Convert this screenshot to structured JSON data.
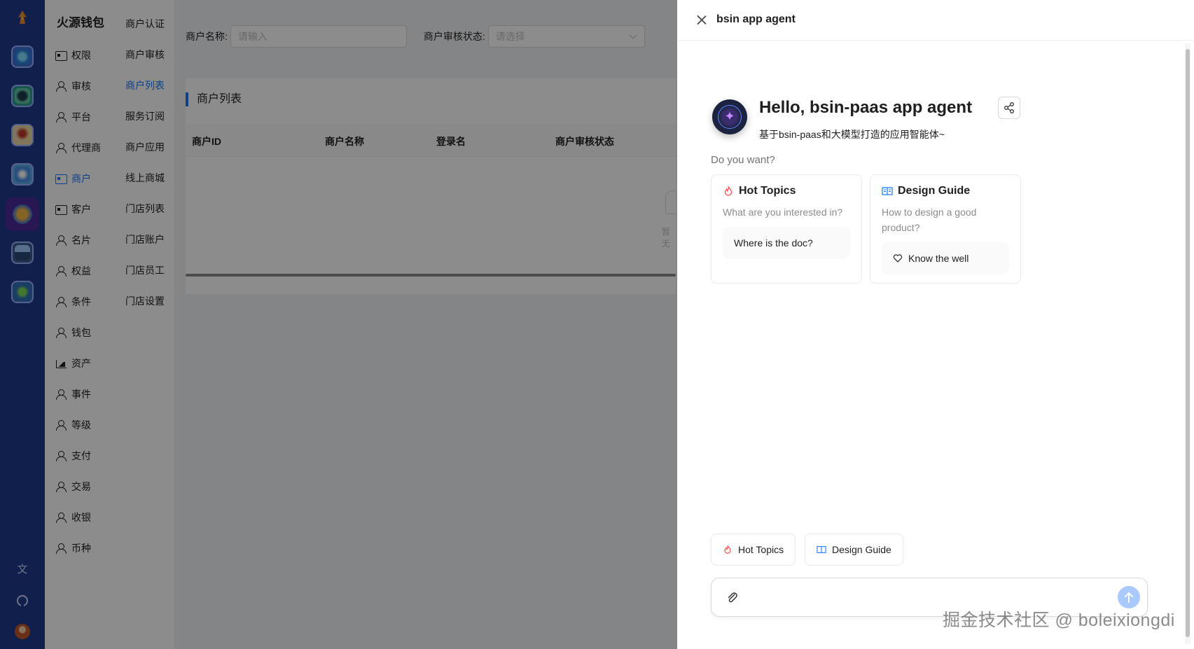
{
  "app": {
    "brand": "火源钱包"
  },
  "menu1": [
    {
      "label": "权限",
      "icon": "id-card-icon"
    },
    {
      "label": "审核",
      "icon": "user-icon"
    },
    {
      "label": "平台",
      "icon": "user-icon"
    },
    {
      "label": "代理商",
      "icon": "user-icon"
    },
    {
      "label": "商户",
      "icon": "id-card-icon",
      "active": true
    },
    {
      "label": "客户",
      "icon": "id-card-icon"
    },
    {
      "label": "名片",
      "icon": "user-icon"
    },
    {
      "label": "权益",
      "icon": "user-icon"
    },
    {
      "label": "条件",
      "icon": "user-icon"
    },
    {
      "label": "钱包",
      "icon": "user-icon"
    },
    {
      "label": "资产",
      "icon": "area-chart-icon"
    },
    {
      "label": "事件",
      "icon": "user-icon"
    },
    {
      "label": "等级",
      "icon": "user-icon"
    },
    {
      "label": "支付",
      "icon": "user-icon"
    },
    {
      "label": "交易",
      "icon": "user-icon"
    },
    {
      "label": "收银",
      "icon": "user-icon"
    },
    {
      "label": "币种",
      "icon": "user-icon"
    }
  ],
  "menu2": [
    {
      "label": "商户认证"
    },
    {
      "label": "商户审核"
    },
    {
      "label": "商户列表",
      "active": true
    },
    {
      "label": "服务订阅"
    },
    {
      "label": "商户应用"
    },
    {
      "label": "线上商城"
    },
    {
      "label": "门店列表"
    },
    {
      "label": "门店账户"
    },
    {
      "label": "门店员工"
    },
    {
      "label": "门店设置"
    }
  ],
  "filter": {
    "name_label": "商户名称:",
    "name_placeholder": "请输入",
    "status_label": "商户审核状态:",
    "status_placeholder": "请选择"
  },
  "table": {
    "title": "商户列表",
    "columns": [
      "商户ID",
      "商户名称",
      "登录名",
      "商户审核状态"
    ],
    "empty_text": "暂无"
  },
  "drawer": {
    "title": "bsin app agent",
    "welcome_title": "Hello, bsin-paas app agent",
    "welcome_sub": "基于bsin-paas和大模型打造的应用智能体~",
    "prompt_heading": "Do you want?",
    "cards": [
      {
        "title": "Hot Topics",
        "icon": "fire-icon",
        "desc": "What are you interested in?",
        "items": [
          {
            "label": "Where is the doc?"
          }
        ]
      },
      {
        "title": "Design Guide",
        "icon": "read-icon",
        "desc": "How to design a good product?",
        "items": [
          {
            "label": "Know the well",
            "icon": "heart-icon"
          }
        ]
      }
    ],
    "chips": [
      {
        "label": "Hot Topics",
        "icon": "fire-icon"
      },
      {
        "label": "Design Guide",
        "icon": "read-icon"
      }
    ]
  },
  "watermark": "掘金技术社区 @ boleixiongdi",
  "colors": {
    "rail": "#1e3a8a",
    "accent": "#1677ff",
    "fire": "#ff4d4f",
    "send": "#a9c9ff"
  }
}
